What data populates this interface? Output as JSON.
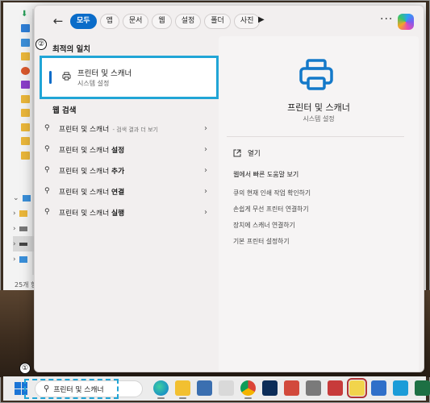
{
  "search_panel": {
    "filters": [
      {
        "label": "모두",
        "active": true
      },
      {
        "label": "앱"
      },
      {
        "label": "문서"
      },
      {
        "label": "웹"
      },
      {
        "label": "설정"
      },
      {
        "label": "폴더"
      },
      {
        "label": "사진"
      }
    ],
    "best_match": {
      "heading": "최적의 일치",
      "title": "프린터 및 스캐너",
      "subtitle": "시스템 설정"
    },
    "web_search": {
      "heading": "웹 검색",
      "items": [
        {
          "prefix": "프린터 및 스캐너",
          "bold": "",
          "suffix": " - 검색 결과 더 보기"
        },
        {
          "prefix": "프린터 및 스캐너 ",
          "bold": "설정",
          "suffix": ""
        },
        {
          "prefix": "프린터 및 스캐너 ",
          "bold": "추가",
          "suffix": ""
        },
        {
          "prefix": "프린터 및 스캐너 ",
          "bold": "연결",
          "suffix": ""
        },
        {
          "prefix": "프린터 및 스캐너 ",
          "bold": "실행",
          "suffix": ""
        }
      ]
    },
    "detail": {
      "title": "프린터 및 스캐너",
      "subtitle": "시스템 설정",
      "open_label": "열기",
      "quick_help_heading": "웹에서 빠른 도움말 보기",
      "help_links": [
        "큐의 현재 인쇄 작업 확인하기",
        "손쉽게 무선 프린터 연결하기",
        "장치에 스캐너 연결하기",
        "기본 프린터 설정하기"
      ]
    }
  },
  "taskbar": {
    "search_text": "프린터 및 스캐너"
  },
  "annotations": {
    "step1": "①",
    "step2": "②"
  },
  "background_window": {
    "status_text": "25개 항"
  },
  "colors": {
    "accent": "#0a6cc9",
    "highlight": "#21a5d6"
  }
}
